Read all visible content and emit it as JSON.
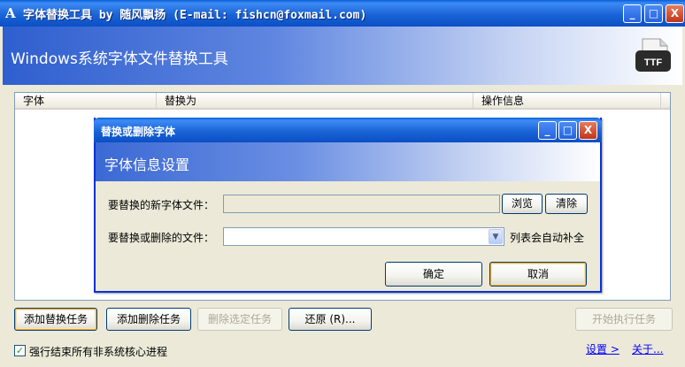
{
  "window": {
    "title": "字体替换工具 by 随风飘扬 (E-mail: fishcn@foxmail.com)",
    "minimize": "_",
    "maximize": "□",
    "close": "X"
  },
  "banner": {
    "title": "Windows系统字体文件替换工具",
    "icon_label": "TTF"
  },
  "task_list": {
    "columns": [
      "字体",
      "替换为",
      "操作信息"
    ]
  },
  "toolbar": {
    "add_replace": "添加替换任务",
    "add_delete": "添加删除任务",
    "delete_selected": "删除选定任务",
    "restore": "还原 (R)...",
    "start": "开始执行任务"
  },
  "options": {
    "force_kill_label": "强行结束所有非系统核心进程",
    "force_kill_checked": true,
    "check_mark": "✓"
  },
  "links": {
    "settings": "设置 >",
    "about": "关于..."
  },
  "dialog": {
    "title": "替换或删除字体",
    "banner_title": "字体信息设置",
    "new_font_label": "要替换的新字体文件：",
    "new_font_value": "",
    "browse": "浏览",
    "clear": "清除",
    "target_label": "要替换或删除的文件：",
    "target_value": "",
    "target_hint": "列表会自动补全",
    "ok": "确定",
    "cancel": "取消",
    "combo_arrow": "▼"
  }
}
